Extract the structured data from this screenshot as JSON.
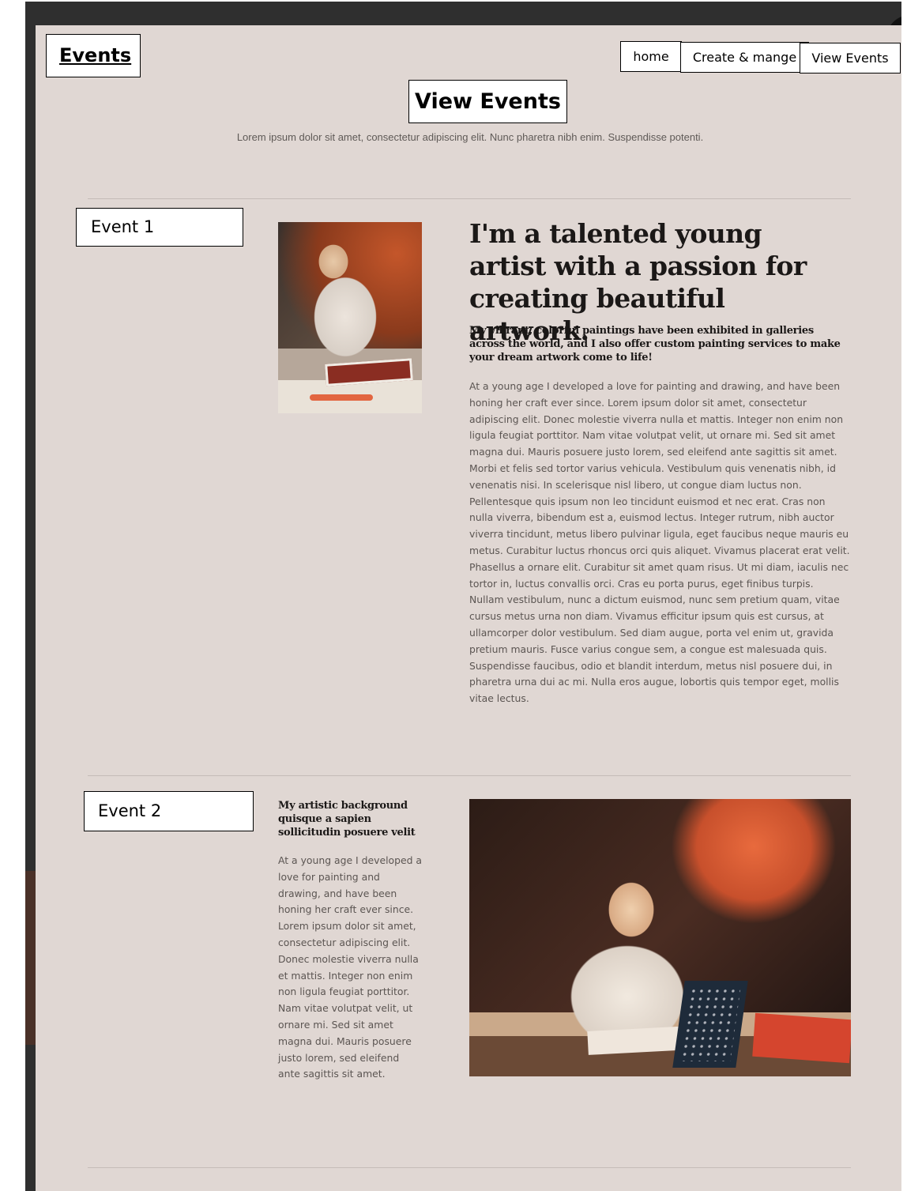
{
  "header": {
    "brand": "Events",
    "nav": [
      "home",
      "Create & mange",
      "View Events"
    ]
  },
  "main": {
    "title": "View Events",
    "intro": "Lorem ipsum dolor sit amet, consectetur adipiscing elit. Nunc pharetra nibh enim. Suspendisse potenti."
  },
  "events": [
    {
      "label": "Event 1",
      "heading": "I'm a talented young artist with a passion for creating beautiful artwork.",
      "subheading": "My vibrant, colorful paintings have been exhibited in galleries across the world, and I also offer custom painting services to make your dream artwork come to life!",
      "body": "At a young age I developed a love for painting and drawing, and have been honing her craft ever since. Lorem ipsum dolor sit amet, consectetur adipiscing elit. Donec molestie viverra nulla et mattis. Integer non enim non ligula feugiat porttitor. Nam vitae volutpat velit, ut ornare mi. Sed sit amet magna dui. Mauris posuere justo lorem, sed eleifend ante sagittis sit amet. Morbi et felis sed tortor varius vehicula. Vestibulum quis venenatis nibh, id venenatis nisi. In scelerisque nisl libero, ut congue diam luctus non. Pellentesque quis ipsum non leo tincidunt euismod et nec erat. Cras non nulla viverra, bibendum est a, euismod lectus. Integer rutrum, nibh auctor viverra tincidunt, metus libero pulvinar ligula, eget faucibus neque mauris eu metus. Curabitur luctus rhoncus orci quis aliquet. Vivamus placerat erat velit. Phasellus a ornare elit. Curabitur sit amet quam risus. Ut mi diam, iaculis nec tortor in, luctus convallis orci. Cras eu porta purus, eget finibus turpis. Nullam vestibulum, nunc a dictum euismod, nunc sem pretium quam, vitae cursus metus urna non diam. Vivamus efficitur ipsum quis est cursus, at ullamcorper dolor vestibulum. Sed diam augue, porta vel enim ut, gravida pretium mauris. Fusce varius congue sem, a congue est malesuada quis. Suspendisse faucibus, odio et blandit interdum, metus nisl posuere dui, in pharetra urna dui ac mi. Nulla eros augue, lobortis quis tempor eget, mollis vitae lectus."
    },
    {
      "label": "Event 2",
      "heading": "My artistic background quisque a sapien sollicitudin posuere velit",
      "body": "At a young age I developed a love for painting and drawing, and have been honing her craft ever since. Lorem ipsum dolor sit amet, consectetur adipiscing elit. Donec molestie viverra nulla et mattis. Integer non enim non ligula feugiat porttitor. Nam vitae volutpat velit, ut ornare mi. Sed sit amet magna dui. Mauris posuere justo lorem, sed eleifend ante sagittis sit amet."
    }
  ],
  "colors": {
    "page_background": "#e0d7d3",
    "frame_background": "#2f2f2f",
    "heading_text": "#1b1817",
    "body_text": "#5b5552"
  }
}
